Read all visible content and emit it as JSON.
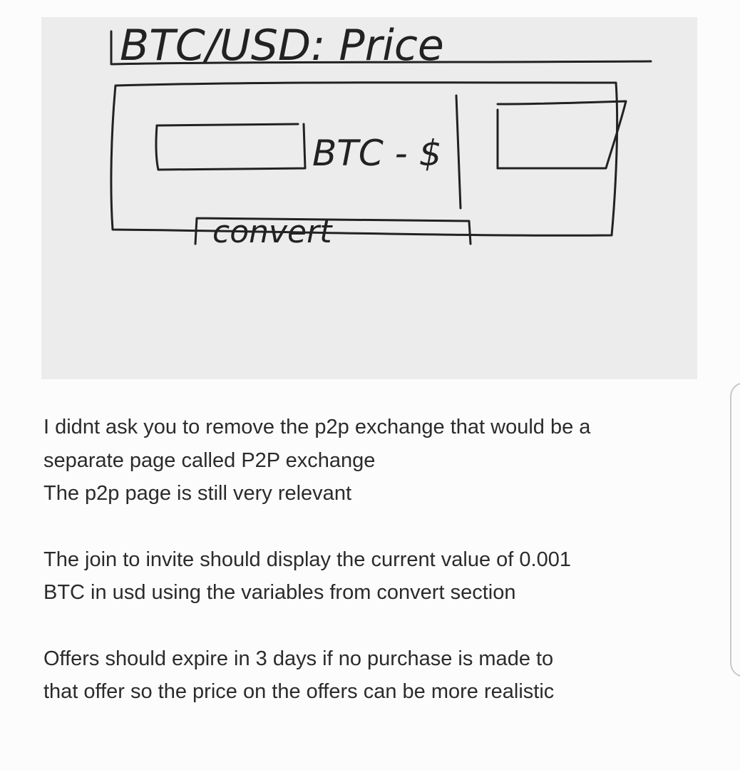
{
  "sketch": {
    "title_text": "BTC/USD: Price",
    "mid_label": "BTC - $",
    "button_label": "convert"
  },
  "message": {
    "lines": [
      "I didnt ask you to remove the p2p exchange that would be a",
      "separate page called P2P exchange",
      "The p2p page is still very relevant",
      "",
      "The join to invite  should display the current value of 0.001",
      "BTC in usd using the variables from convert section",
      "",
      "Offers should expire in 3 days if no purchase is made to",
      "that offer so the price on the offers can be more realistic"
    ]
  },
  "colors": {
    "page_bg": "#fcfcfc",
    "panel_bg": "#ececec",
    "ink": "#222222",
    "text": "#2b2b2b",
    "edge": "#c9c9c9"
  }
}
